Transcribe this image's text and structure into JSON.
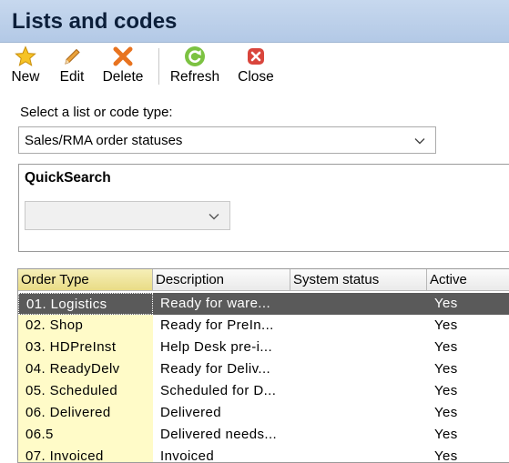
{
  "window": {
    "title": "Lists and codes"
  },
  "toolbar": {
    "new_label": "New",
    "edit_label": "Edit",
    "delete_label": "Delete",
    "refresh_label": "Refresh",
    "close_label": "Close"
  },
  "list_select": {
    "label": "Select a list or code type:",
    "value": "Sales/RMA order statuses"
  },
  "quicksearch": {
    "title": "QuickSearch",
    "value": ""
  },
  "grid": {
    "columns": [
      "Order Type",
      "Description",
      "System status",
      "Active"
    ],
    "rows": [
      {
        "order_type": "01. Logistics",
        "description": "Ready for ware...",
        "system_status": "",
        "active": "Yes",
        "selected": true
      },
      {
        "order_type": "02. Shop",
        "description": "Ready for PreIn...",
        "system_status": "",
        "active": "Yes"
      },
      {
        "order_type": "03. HDPreInst",
        "description": "Help Desk pre-i...",
        "system_status": "",
        "active": "Yes"
      },
      {
        "order_type": "04. ReadyDelv",
        "description": "Ready for Deliv...",
        "system_status": "",
        "active": "Yes"
      },
      {
        "order_type": "05. Scheduled",
        "description": "Scheduled for D...",
        "system_status": "",
        "active": "Yes"
      },
      {
        "order_type": "06. Delivered",
        "description": "Delivered",
        "system_status": "",
        "active": "Yes"
      },
      {
        "order_type": "06.5",
        "description": "Delivered needs...",
        "system_status": "",
        "active": "Yes"
      },
      {
        "order_type": "07. Invoiced",
        "description": "Invoiced",
        "system_status": "",
        "active": "Yes"
      }
    ]
  },
  "colors": {
    "title_bar": "#b8cde8",
    "key_column": "#fffbc8",
    "selected_row": "#5a5a5a",
    "sorted_header": "#ede08e"
  },
  "icons": [
    "star-icon",
    "pencil-icon",
    "delete-x-icon",
    "refresh-icon",
    "close-icon",
    "chevron-down-icon"
  ]
}
